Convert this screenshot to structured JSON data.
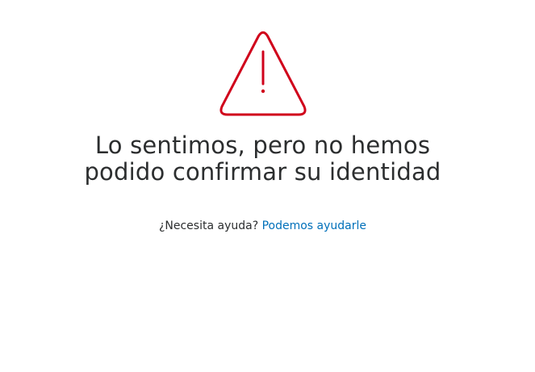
{
  "error": {
    "icon": "warning-triangle-icon",
    "icon_color": "#d0021b",
    "title_line1": "Lo sentimos, pero no hemos",
    "title_line2": "podido confirmar su identidad"
  },
  "help": {
    "prompt": "¿Necesita ayuda?",
    "link_label": "Podemos ayudarle",
    "link_color": "#0070ba"
  }
}
